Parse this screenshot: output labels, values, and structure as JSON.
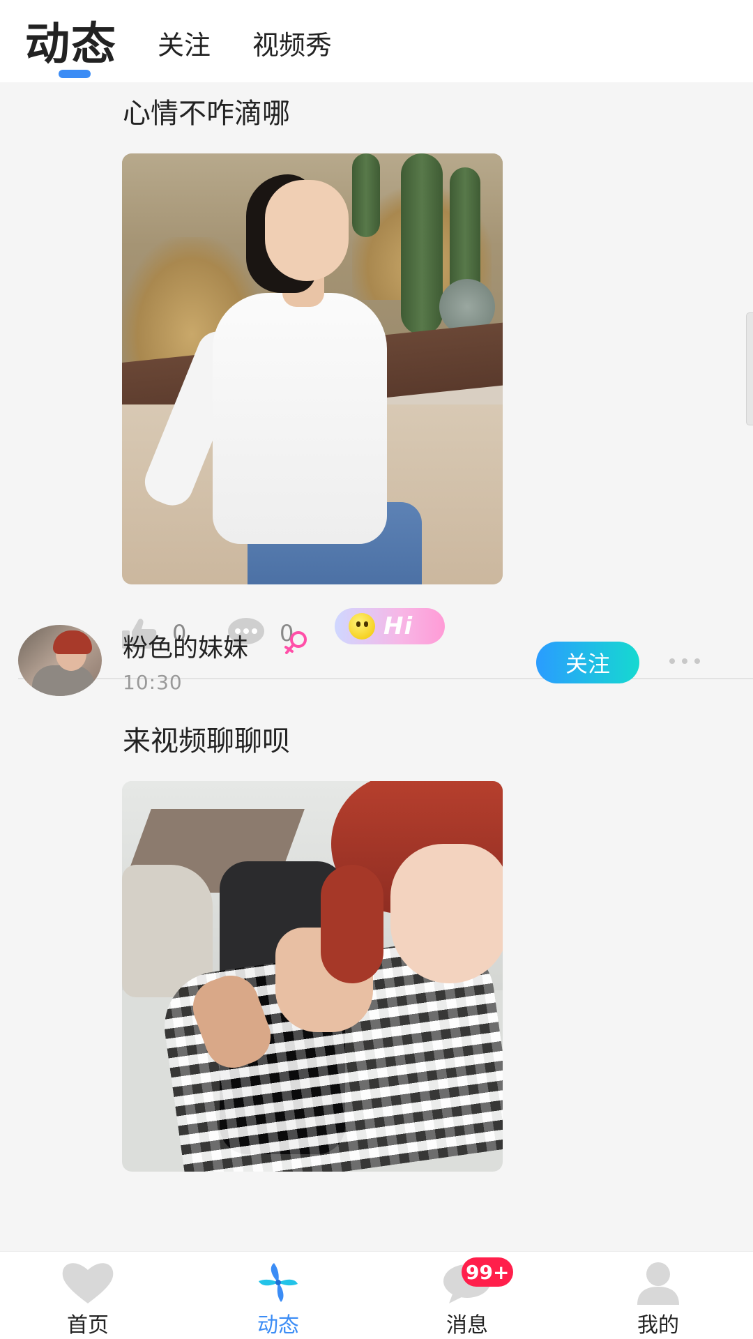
{
  "header": {
    "tabs": [
      {
        "label": "动态",
        "active": true
      },
      {
        "label": "关注",
        "active": false
      },
      {
        "label": "视频秀",
        "active": false
      }
    ],
    "accent_color": "#3b8cf5"
  },
  "feed": {
    "posts": [
      {
        "text": "心情不咋滴哪",
        "image": "photo-woman-white-top-cacti",
        "likes": "0",
        "comments": "0",
        "hi_button_label": "Hi"
      },
      {
        "username": "粉色的妹妹",
        "gender_icon": "female-icon",
        "time": "10:30",
        "follow_label": "关注",
        "text": "来视频聊聊呗",
        "image": "photo-red-hair-woman-plaid"
      }
    ]
  },
  "bottom_nav": {
    "items": [
      {
        "label": "首页",
        "icon": "heart-icon",
        "active": false
      },
      {
        "label": "动态",
        "icon": "pinwheel-icon",
        "active": true
      },
      {
        "label": "消息",
        "icon": "chat-bubble-icon",
        "active": false,
        "badge": "99+"
      },
      {
        "label": "我的",
        "icon": "user-icon",
        "active": false
      }
    ]
  },
  "colors": {
    "follow_gradient_start": "#2a9cff",
    "follow_gradient_end": "#16d9d0",
    "badge_red": "#ff1f4b",
    "female_pink": "#ff4fa8"
  }
}
